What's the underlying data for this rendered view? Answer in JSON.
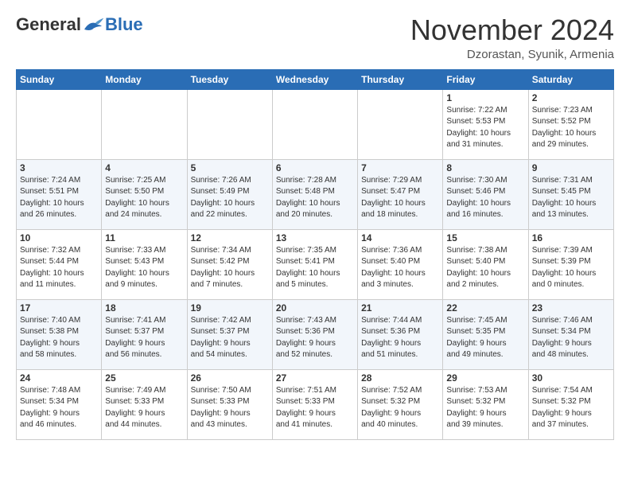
{
  "header": {
    "logo_general": "General",
    "logo_blue": "Blue",
    "month_title": "November 2024",
    "location": "Dzorastan, Syunik, Armenia"
  },
  "days_of_week": [
    "Sunday",
    "Monday",
    "Tuesday",
    "Wednesday",
    "Thursday",
    "Friday",
    "Saturday"
  ],
  "weeks": [
    [
      {
        "day": "",
        "info": ""
      },
      {
        "day": "",
        "info": ""
      },
      {
        "day": "",
        "info": ""
      },
      {
        "day": "",
        "info": ""
      },
      {
        "day": "",
        "info": ""
      },
      {
        "day": "1",
        "info": "Sunrise: 7:22 AM\nSunset: 5:53 PM\nDaylight: 10 hours\nand 31 minutes."
      },
      {
        "day": "2",
        "info": "Sunrise: 7:23 AM\nSunset: 5:52 PM\nDaylight: 10 hours\nand 29 minutes."
      }
    ],
    [
      {
        "day": "3",
        "info": "Sunrise: 7:24 AM\nSunset: 5:51 PM\nDaylight: 10 hours\nand 26 minutes."
      },
      {
        "day": "4",
        "info": "Sunrise: 7:25 AM\nSunset: 5:50 PM\nDaylight: 10 hours\nand 24 minutes."
      },
      {
        "day": "5",
        "info": "Sunrise: 7:26 AM\nSunset: 5:49 PM\nDaylight: 10 hours\nand 22 minutes."
      },
      {
        "day": "6",
        "info": "Sunrise: 7:28 AM\nSunset: 5:48 PM\nDaylight: 10 hours\nand 20 minutes."
      },
      {
        "day": "7",
        "info": "Sunrise: 7:29 AM\nSunset: 5:47 PM\nDaylight: 10 hours\nand 18 minutes."
      },
      {
        "day": "8",
        "info": "Sunrise: 7:30 AM\nSunset: 5:46 PM\nDaylight: 10 hours\nand 16 minutes."
      },
      {
        "day": "9",
        "info": "Sunrise: 7:31 AM\nSunset: 5:45 PM\nDaylight: 10 hours\nand 13 minutes."
      }
    ],
    [
      {
        "day": "10",
        "info": "Sunrise: 7:32 AM\nSunset: 5:44 PM\nDaylight: 10 hours\nand 11 minutes."
      },
      {
        "day": "11",
        "info": "Sunrise: 7:33 AM\nSunset: 5:43 PM\nDaylight: 10 hours\nand 9 minutes."
      },
      {
        "day": "12",
        "info": "Sunrise: 7:34 AM\nSunset: 5:42 PM\nDaylight: 10 hours\nand 7 minutes."
      },
      {
        "day": "13",
        "info": "Sunrise: 7:35 AM\nSunset: 5:41 PM\nDaylight: 10 hours\nand 5 minutes."
      },
      {
        "day": "14",
        "info": "Sunrise: 7:36 AM\nSunset: 5:40 PM\nDaylight: 10 hours\nand 3 minutes."
      },
      {
        "day": "15",
        "info": "Sunrise: 7:38 AM\nSunset: 5:40 PM\nDaylight: 10 hours\nand 2 minutes."
      },
      {
        "day": "16",
        "info": "Sunrise: 7:39 AM\nSunset: 5:39 PM\nDaylight: 10 hours\nand 0 minutes."
      }
    ],
    [
      {
        "day": "17",
        "info": "Sunrise: 7:40 AM\nSunset: 5:38 PM\nDaylight: 9 hours\nand 58 minutes."
      },
      {
        "day": "18",
        "info": "Sunrise: 7:41 AM\nSunset: 5:37 PM\nDaylight: 9 hours\nand 56 minutes."
      },
      {
        "day": "19",
        "info": "Sunrise: 7:42 AM\nSunset: 5:37 PM\nDaylight: 9 hours\nand 54 minutes."
      },
      {
        "day": "20",
        "info": "Sunrise: 7:43 AM\nSunset: 5:36 PM\nDaylight: 9 hours\nand 52 minutes."
      },
      {
        "day": "21",
        "info": "Sunrise: 7:44 AM\nSunset: 5:36 PM\nDaylight: 9 hours\nand 51 minutes."
      },
      {
        "day": "22",
        "info": "Sunrise: 7:45 AM\nSunset: 5:35 PM\nDaylight: 9 hours\nand 49 minutes."
      },
      {
        "day": "23",
        "info": "Sunrise: 7:46 AM\nSunset: 5:34 PM\nDaylight: 9 hours\nand 48 minutes."
      }
    ],
    [
      {
        "day": "24",
        "info": "Sunrise: 7:48 AM\nSunset: 5:34 PM\nDaylight: 9 hours\nand 46 minutes."
      },
      {
        "day": "25",
        "info": "Sunrise: 7:49 AM\nSunset: 5:33 PM\nDaylight: 9 hours\nand 44 minutes."
      },
      {
        "day": "26",
        "info": "Sunrise: 7:50 AM\nSunset: 5:33 PM\nDaylight: 9 hours\nand 43 minutes."
      },
      {
        "day": "27",
        "info": "Sunrise: 7:51 AM\nSunset: 5:33 PM\nDaylight: 9 hours\nand 41 minutes."
      },
      {
        "day": "28",
        "info": "Sunrise: 7:52 AM\nSunset: 5:32 PM\nDaylight: 9 hours\nand 40 minutes."
      },
      {
        "day": "29",
        "info": "Sunrise: 7:53 AM\nSunset: 5:32 PM\nDaylight: 9 hours\nand 39 minutes."
      },
      {
        "day": "30",
        "info": "Sunrise: 7:54 AM\nSunset: 5:32 PM\nDaylight: 9 hours\nand 37 minutes."
      }
    ]
  ]
}
